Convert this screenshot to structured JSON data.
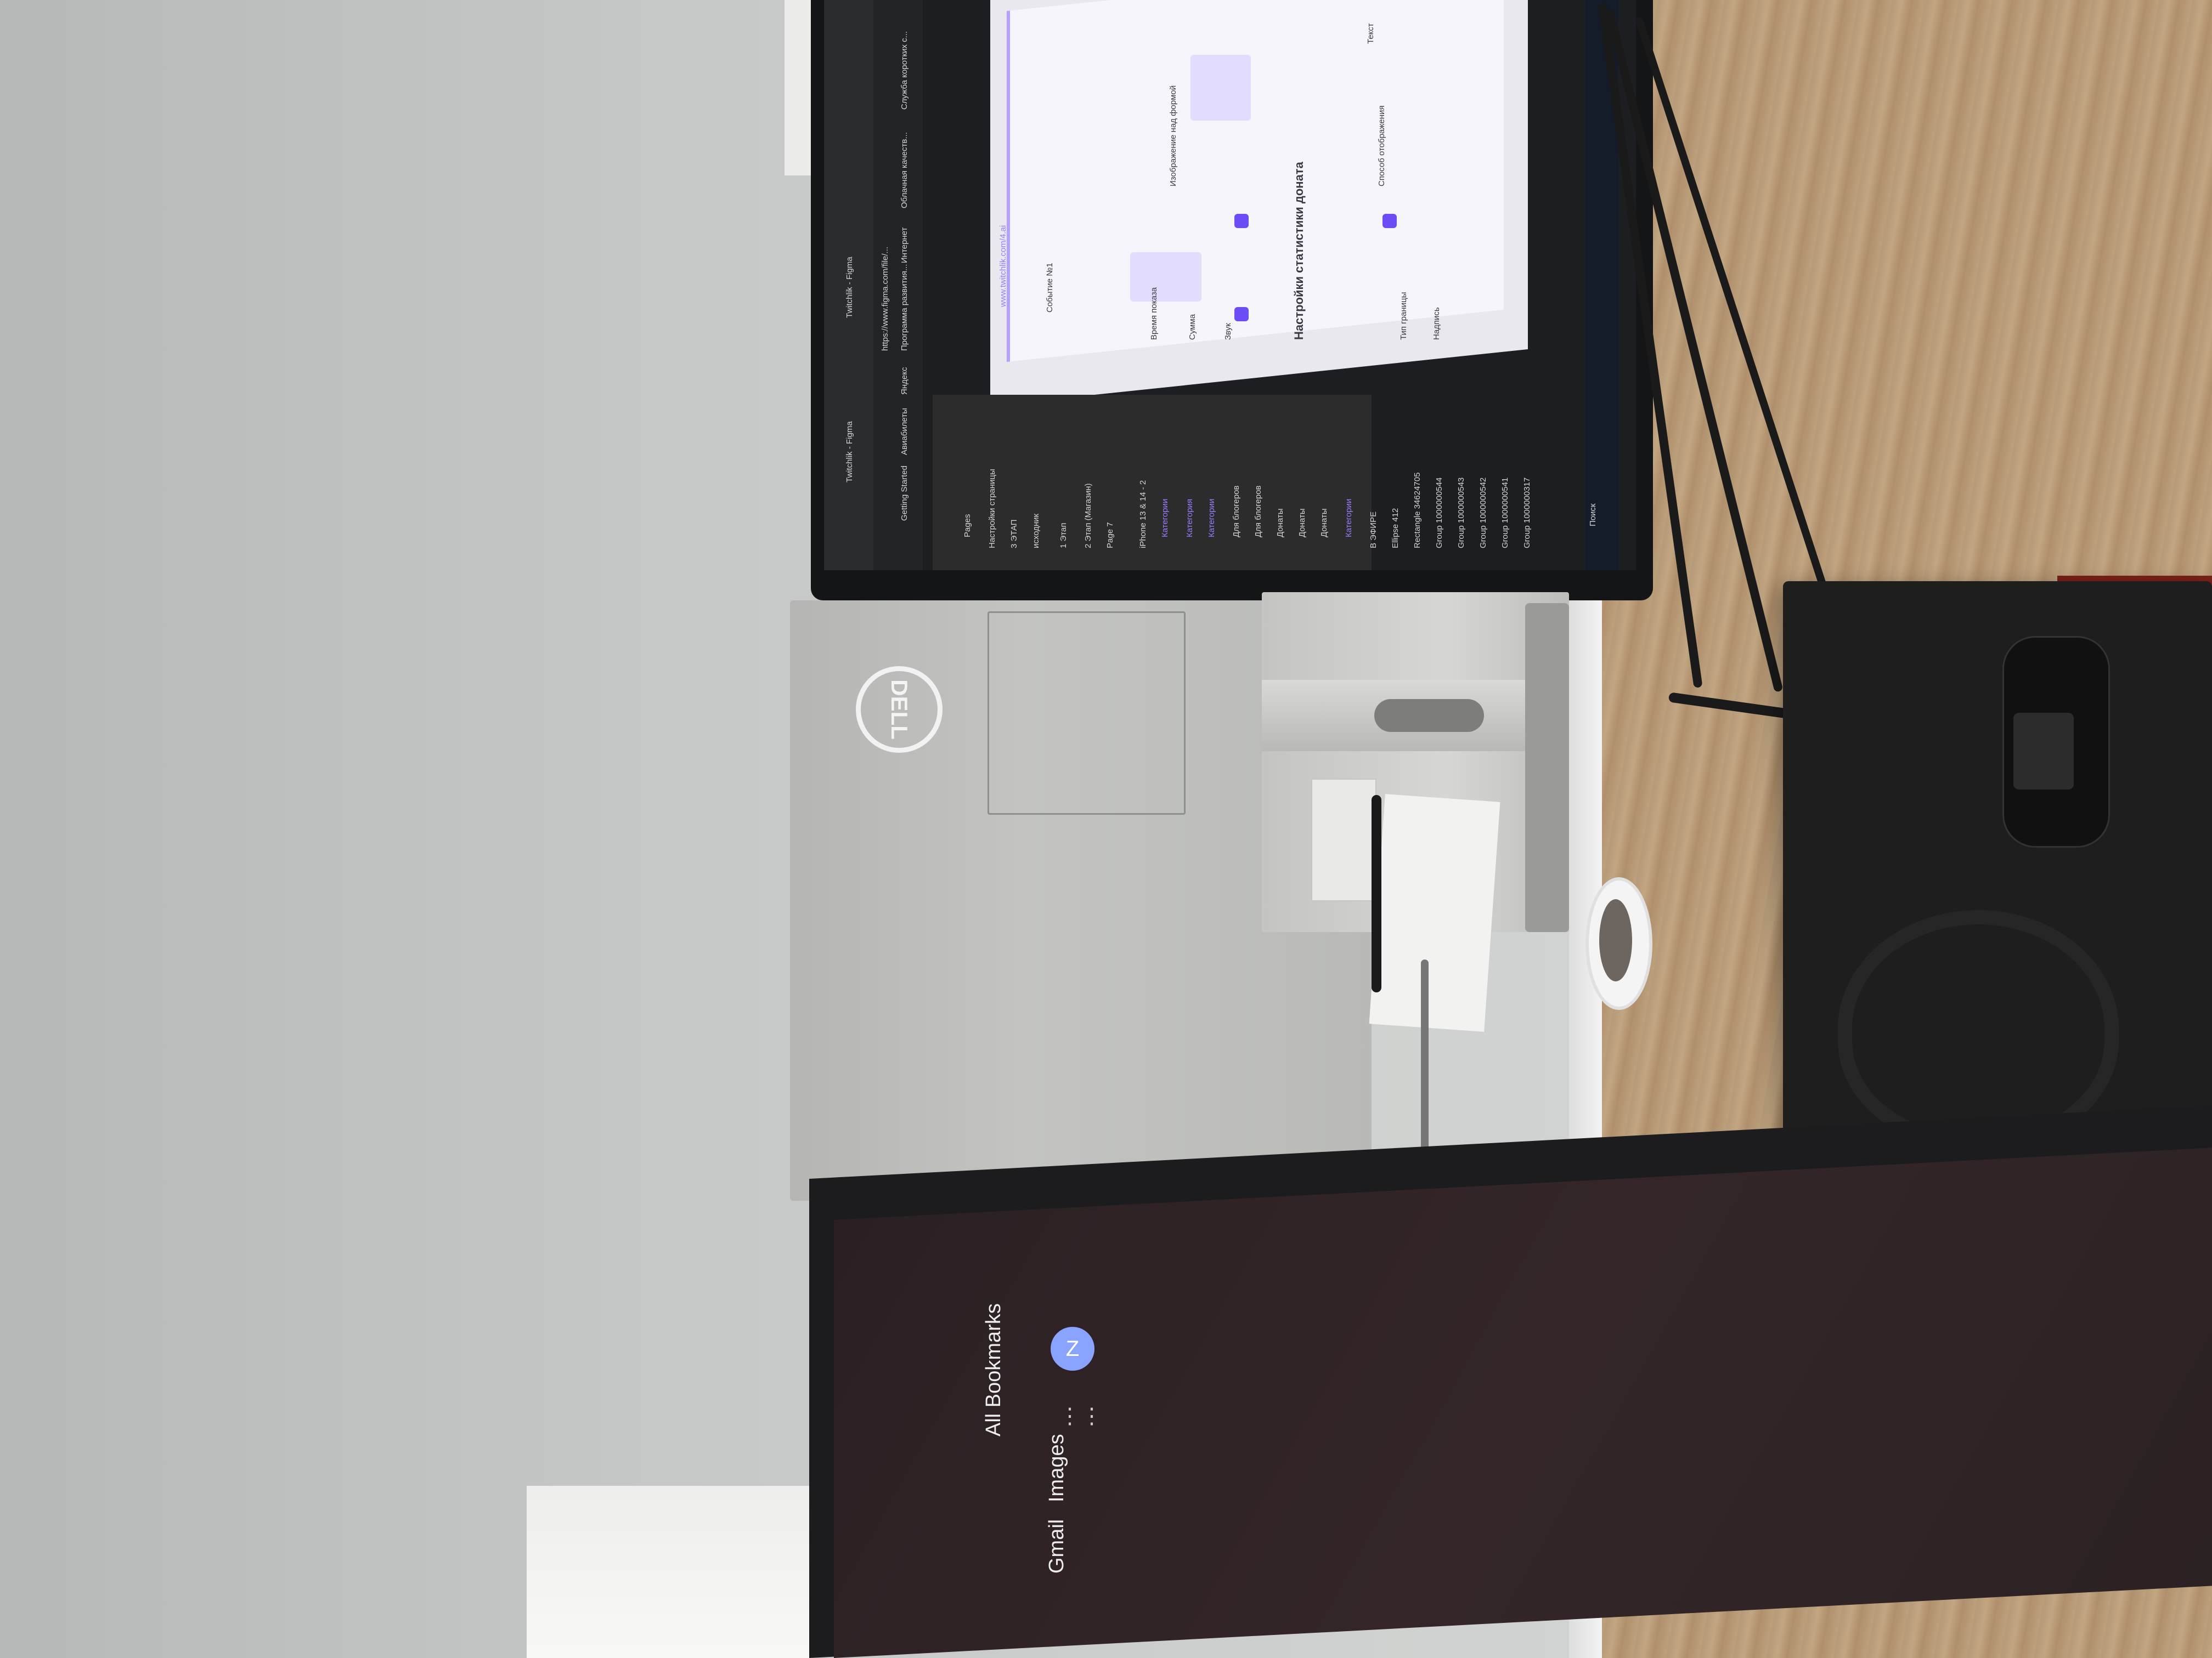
{
  "scene": {
    "description_tags": [
      "monitor",
      "desk",
      "keys",
      "headphones",
      "second-monitor"
    ],
    "brand_logo": "DELL",
    "colors": {
      "wall": "#c6c8c8",
      "desk": "#bca07c",
      "bezel": "#141516",
      "figma_accent": "#6b4cf5"
    }
  },
  "monitor_screen": {
    "browser_tabs": [
      "Twitchlik - Figma",
      "Twitchlik - Figma"
    ],
    "url": "https://www.figma.com/file/...",
    "bookmarks": [
      "Getting Started",
      "Авиабилеты",
      "Яндекс",
      "Программа развития...",
      "Интернет",
      "Облачная качеств...",
      "Служба коротких с..."
    ],
    "figma_left_panel": {
      "pages_header": "Pages",
      "pages": [
        "Настройки страницы",
        "3 ЭТАП",
        "исходник",
        "1 Этап",
        "2 Этап (Магазин)",
        "Page 7"
      ],
      "layers_header": "iPhone 13 & 14 - 2",
      "layers": [
        "Категории",
        "Категория",
        "Категории",
        "Для блогеров",
        "Для блогеров",
        "Донаты",
        "Донаты",
        "Донаты",
        "Категории",
        "В ЭФИРЕ",
        "Ellipse 412",
        "Rectangle 34624705",
        "Group 1000000544",
        "Group 1000000543",
        "Group 1000000542",
        "Group 1000000541",
        "Group 1000000317"
      ]
    },
    "canvas_texts": {
      "section_title": "Настройки статистики доната",
      "link_text": "www.twitchlik.com/4.ai",
      "subscription_label": "Событие №1",
      "sub_items": [
        "Время показа",
        "Сумма",
        "Звук",
        "Изображение над формой",
        "Способ отображения",
        "Текст",
        "Тип границы",
        "Надпись"
      ]
    },
    "search_label": "Поиск"
  },
  "second_monitor": {
    "toolbar_labels": [
      "Gmail",
      "Images",
      "All Bookmarks"
    ],
    "avatar_letter": "Z"
  }
}
